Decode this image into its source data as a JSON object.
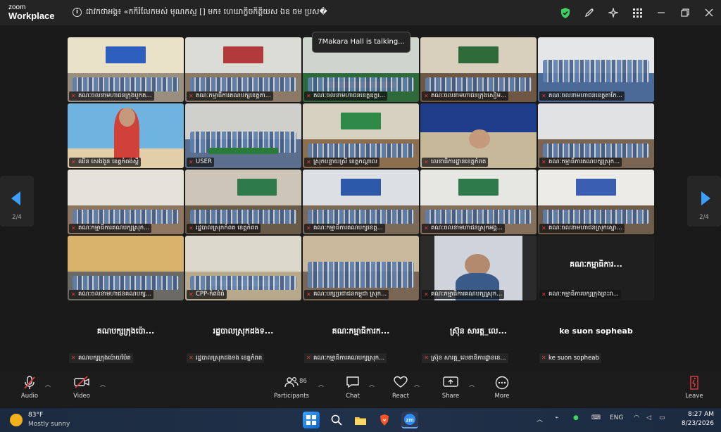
{
  "window": {
    "app_name_line1": "zoom",
    "app_name_line2": "Workplace",
    "meeting_title": "ជាវកថាអង្គ៖ «កកិរំលែកមស់ មុណកស្ម [] មក៖ ហេឃាក្ខិចកិត្តិយស ឯឧ ចម ប្រស�"
  },
  "talking_indicator": "7Makara Hall is talking...",
  "pager": {
    "left_page": "2/4",
    "right_page": "2/4"
  },
  "video_tiles": [
    {
      "label": "គណៈចលនាមហាជនក្រុងបូកគ..."
    },
    {
      "label": "គណៈកម្មាធិការគណបក្សខេត្តតា..."
    },
    {
      "label": "គណៈចលនាមហាជនខេត្តឧត្តរ..."
    },
    {
      "label": "គណៈចលនាមហាជនក្រុងសៀម..."
    },
    {
      "label": "គណៈចលនាមហាជនខេត្តតាកែ..."
    },
    {
      "label": "ឈិន សេងងួន ខេត្តកំពង់ស្ពឺ"
    },
    {
      "label": "USER"
    },
    {
      "label": "ស្រុកបន្ទាយស្រី ខេត្តកណ្ដាល"
    },
    {
      "label": "លេខាធិការដ្ឋានខេត្តកំពត"
    },
    {
      "label": "គណៈកម្មាធិការគណបក្សស្រុក..."
    },
    {
      "label": "គណៈកម្មាធិការគណបក្សស្រុក..."
    },
    {
      "label": "រដ្ឋបាលស្រុកកំពត ខេត្តកំពត"
    },
    {
      "label": "គណៈកម្មាធិការគណបក្សខេត្ត..."
    },
    {
      "label": "គណៈចលនាមហាជនស្រុកអង្គ..."
    },
    {
      "label": "គណៈចលនាមហាជនស្រុកស្នោ..."
    },
    {
      "label": "គណៈចលនាមហាជនគណបក្ស..."
    },
    {
      "label": "CPP-កំពង់ធំ"
    },
    {
      "label": "គណៈបក្សប្រជាជនកម្ពុជា ស្រុក..."
    },
    {
      "label": "គណៈកម្មាធិការគណបក្សស្រុក..."
    },
    {
      "label": "គណៈកម្មាធិការបក្សក្រុងព្រះរា..."
    }
  ],
  "video_off_big_name_tile20": "គណៈកម្មាធិការ...",
  "bottom_participants": [
    {
      "big": "គណបក្សក្រុងប៉ោ...",
      "label": "គណបក្សក្រុងប៉ោយប៉ែត"
    },
    {
      "big": "រដ្ឋបាលស្រុកដងទ...",
      "label": "រដ្ឋបាលស្រុកដងទង ខេត្តកំពត"
    },
    {
      "big": "គណៈកម្មាធិការក...",
      "label": "គណៈកម្មាធិការគណបក្សស្រុក..."
    },
    {
      "big": "ស្រ៊ុន សារត្ត_លេ...",
      "label": "ស្រ៊ុន សារត្ត_លេខាធិការដ្ឋានខេ..."
    },
    {
      "big": "ke suon sopheab",
      "label": "ke suon sopheab"
    }
  ],
  "toolbar": {
    "audio": "Audio",
    "video": "Video",
    "participants": "Participants",
    "participants_count": "86",
    "chat": "Chat",
    "react": "React",
    "share": "Share",
    "more": "More",
    "leave": "Leave"
  },
  "taskbar": {
    "temp": "83°F",
    "condition": "Mostly sunny",
    "lang": "ENG",
    "time": "8:27 AM",
    "date": "8/23/2026"
  },
  "colors": {
    "accent": "#3aa0ff",
    "muted_mic": "#e04040",
    "shield": "#3ecf5e"
  }
}
